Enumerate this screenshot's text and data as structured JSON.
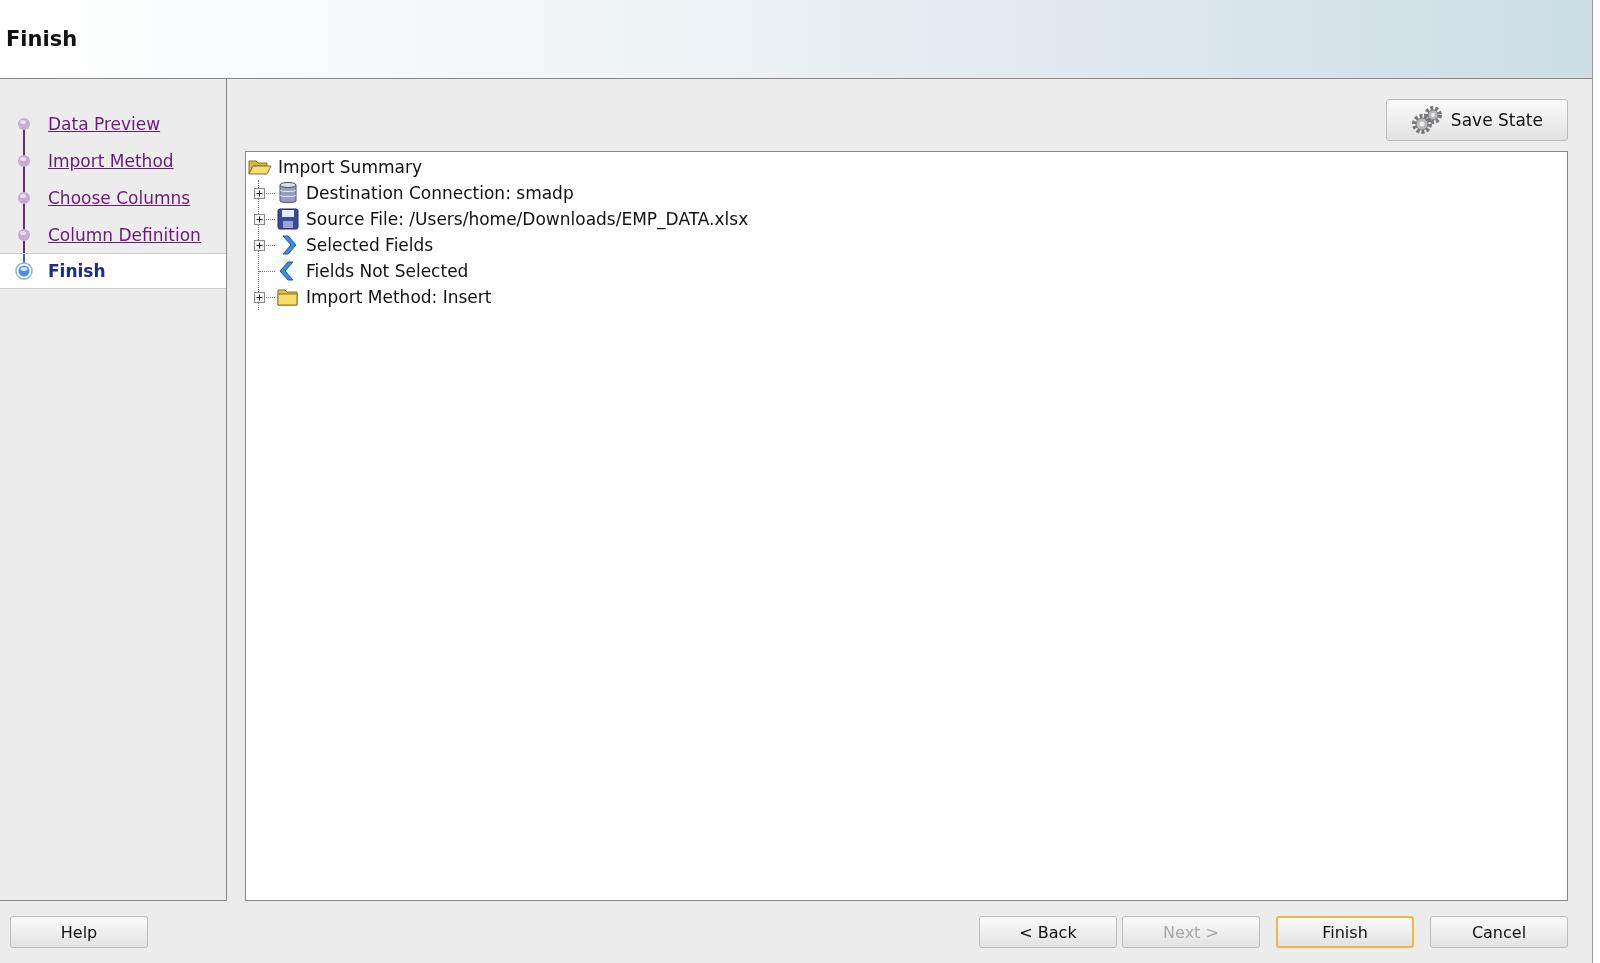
{
  "window": {
    "title": "Finish"
  },
  "steps": [
    {
      "label": "Data Preview",
      "selected": false
    },
    {
      "label": "Import Method",
      "selected": false
    },
    {
      "label": "Choose Columns",
      "selected": false
    },
    {
      "label": "Column Definition",
      "selected": false
    },
    {
      "label": "Finish",
      "selected": true
    }
  ],
  "save_button": {
    "label": "Save State"
  },
  "tree": {
    "label": "Import Summary",
    "expanded": true,
    "children": [
      {
        "label": "Destination Connection: smadp",
        "kind": "database",
        "expandable": true
      },
      {
        "label": "Source File: /Users/home/Downloads/EMP_DATA.xlsx",
        "kind": "disk",
        "expandable": true
      },
      {
        "label": "Selected Fields",
        "kind": "forward",
        "expandable": true
      },
      {
        "label": "Fields Not Selected",
        "kind": "back",
        "expandable": false
      },
      {
        "label": "Import Method: Insert",
        "kind": "folder",
        "expandable": true
      }
    ]
  },
  "left_buttons": [
    {
      "label": "Help",
      "disabled": false,
      "default": false
    }
  ],
  "right_buttons": [
    {
      "label": "< Back",
      "disabled": false,
      "default": false
    },
    {
      "label": "Next >",
      "disabled": true,
      "default": false
    },
    {
      "label": "Finish",
      "disabled": false,
      "default": true
    },
    {
      "label": "Cancel",
      "disabled": false,
      "default": false
    }
  ]
}
